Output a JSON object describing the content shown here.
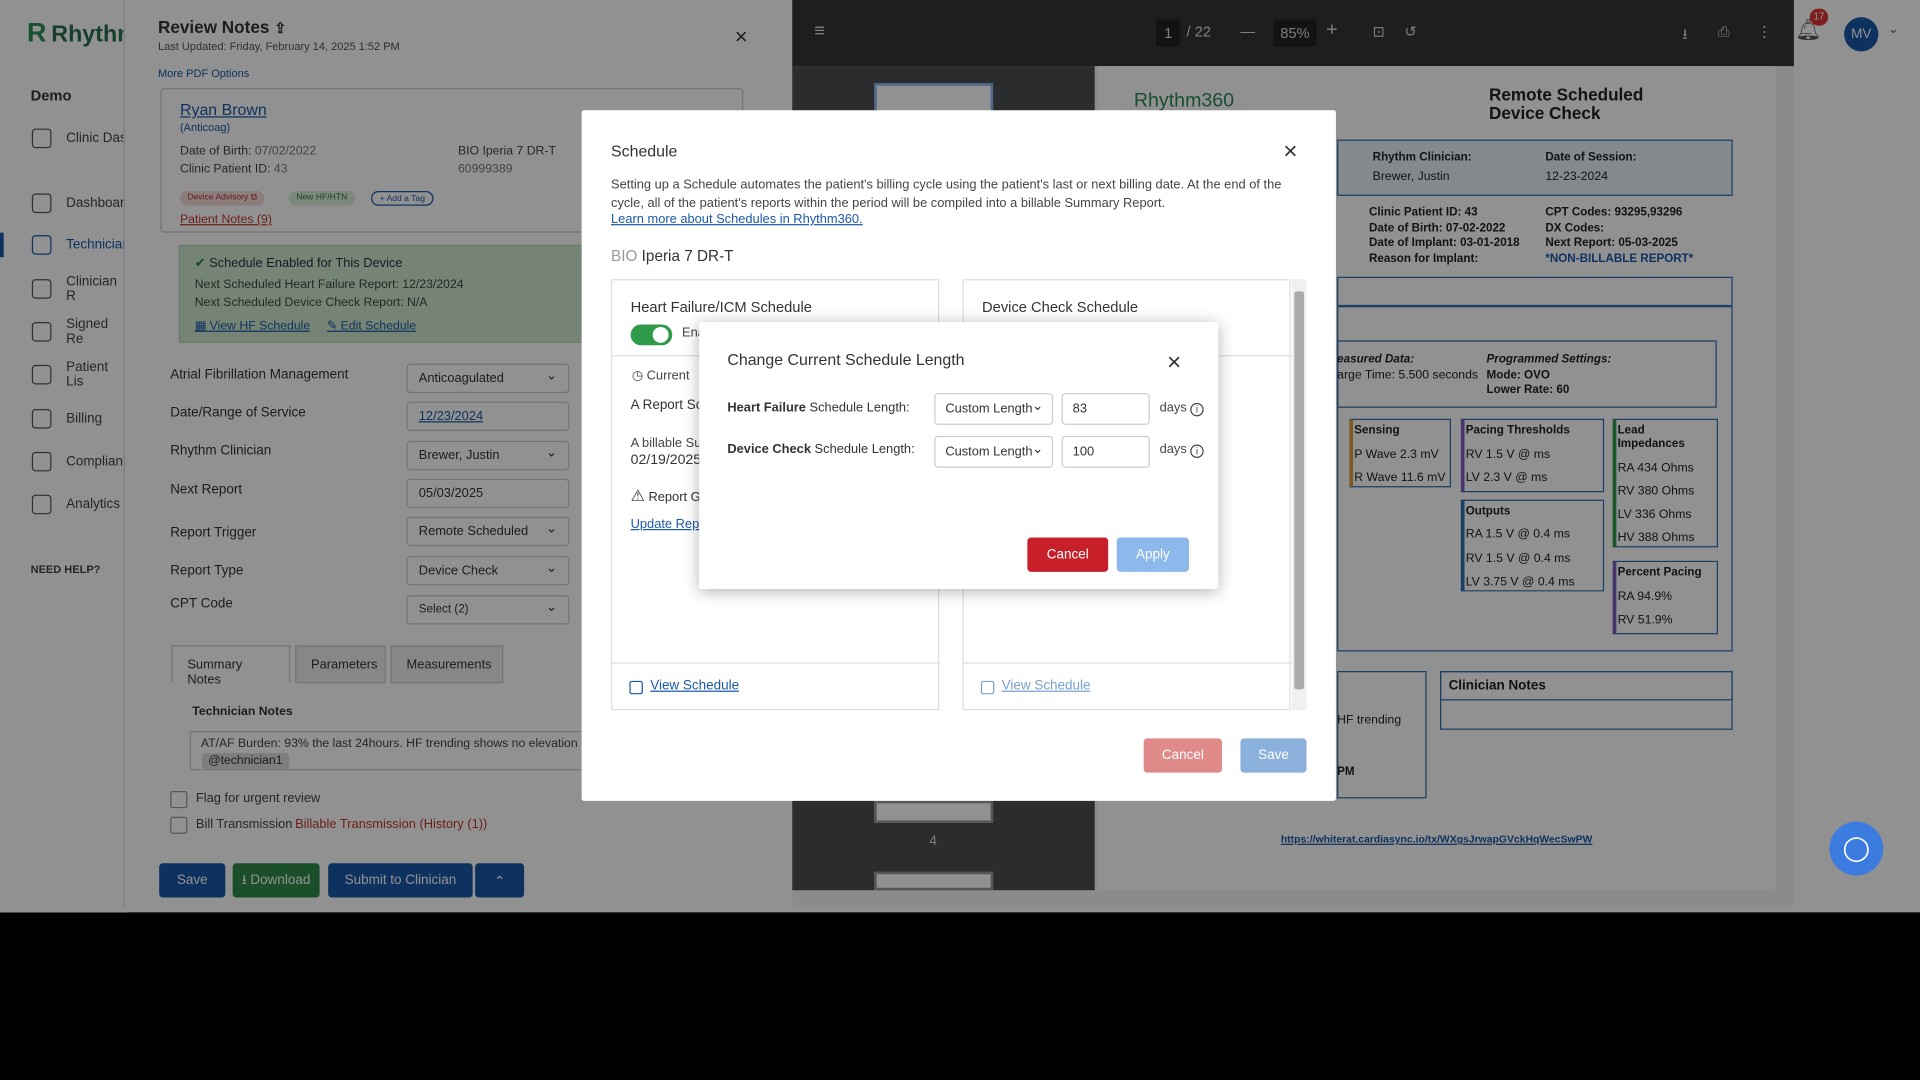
{
  "sidebar": {
    "logo": "Rhythm",
    "section": "Demo",
    "items": [
      {
        "label": "Clinic Das"
      },
      {
        "label": "Dashboar"
      },
      {
        "label": "Technician"
      },
      {
        "label": "Clinician R"
      },
      {
        "label": "Signed Re"
      },
      {
        "label": "Patient Lis"
      },
      {
        "label": "Billing"
      },
      {
        "label": "Complianc"
      },
      {
        "label": "Analytics"
      }
    ],
    "help": "NEED HELP?"
  },
  "review": {
    "title": "Review Notes",
    "updated": "Last Updated: Friday, February 14, 2025 1:52 PM",
    "more_pdf": "More PDF Options",
    "patient": {
      "name": "Ryan Brown",
      "subtitle": "(Anticoag)",
      "dob_label": "Date of Birth:",
      "dob": "07/02/2022",
      "clinic_id_label": "Clinic Patient ID:",
      "clinic_id": "43",
      "device": "BIO Iperia 7 DR-T",
      "serial": "60999389",
      "tags": [
        "Device Advisory",
        "New HF/HTN",
        "+ Add a Tag"
      ],
      "notes_link": "Patient Notes (9)"
    },
    "schedule_box": {
      "title": "Schedule Enabled for This Device",
      "hf_next": "Next Scheduled Heart Failure Report: 12/23/2024",
      "dc_next": "Next Scheduled Device Check Report: N/A",
      "view_hf": "View HF Schedule",
      "edit": "Edit Schedule"
    },
    "fields": [
      {
        "label": "Atrial Fibrillation Management",
        "value": "Anticoagulated"
      },
      {
        "label": "Date/Range of Service",
        "value": "12/23/2024"
      },
      {
        "label": "Rhythm Clinician",
        "value": "Brewer, Justin"
      },
      {
        "label": "Next Report",
        "value": "05/03/2025"
      },
      {
        "label": "Report Trigger",
        "value": "Remote Scheduled"
      },
      {
        "label": "Report Type",
        "value": "Device Check"
      },
      {
        "label": "CPT Code",
        "value": "Select (2)"
      }
    ],
    "tabs": [
      "Summary Notes",
      "Parameters",
      "Measurements"
    ],
    "tech_notes_label": "Technician Notes",
    "tech_notes": "AT/AF Burden: 93% the last 24hours. HF trending shows no elevation",
    "mention": "@technician1",
    "flag_label": "Flag for urgent review",
    "bill_label": "Bill Transmission",
    "bill_link": "Billable Transmission (History (1))",
    "buttons": {
      "save": "Save",
      "download": "Download",
      "submit": "Submit to Clinician"
    }
  },
  "pdf": {
    "page": "1",
    "pages": "/ 22",
    "zoom": "85%",
    "notifications": "17",
    "avatar": "MV",
    "thumb_number": "4",
    "report": {
      "logo": "Rhythm360",
      "title_1": "Remote Scheduled",
      "title_2": "Device Check",
      "clinician_label": "Rhythm Clinician:",
      "clinician": "Brewer, Justin",
      "session_label": "Date of Session:",
      "session": "12-23-2024",
      "clinic_id": "Clinic Patient ID: 43",
      "dob": "Date of Birth: 07-02-2022",
      "implant": "Date of Implant: 03-01-2018",
      "reason": "Reason for Implant:",
      "cpt": "CPT Codes: 93295,93296",
      "dx": "DX Codes:",
      "next": "Next Report: 05-03-2025",
      "nonbill": "*NON-BILLABLE REPORT*",
      "measured": "easured Data:",
      "charge": "arge Time: 5.500 seconds",
      "prog": "Programmed Settings:",
      "mode": "Mode: OVO",
      "lower": "Lower Rate: 60",
      "sensing": "Sensing",
      "pwave": "P Wave   2.3 mV",
      "rwave": "R Wave   11.6 mV",
      "pacing": "Pacing Thresholds",
      "rv_p": "RV     1.5 V @ ms",
      "lv_p": "LV     2.3 V @ ms",
      "leads": "Lead Impedances",
      "ra_i": "RA   434 Ohms",
      "rv_i": "RV   380 Ohms",
      "lv_i": "LV   336 Ohms",
      "hv_i": "HV   388 Ohms",
      "outputs": "Outputs",
      "ra_o": "RA   1.5 V @ 0.4 ms",
      "rv_o": "RV   1.5 V @ 0.4 ms",
      "lv_o": "LV   3.75 V @ 0.4 ms",
      "pct": "Percent Pacing",
      "ra_pct": "RA   94.9%",
      "rv_pct": "RV   51.9%",
      "clin_notes": "Clinician Notes",
      "hf_trend": "HF trending",
      "pm": "PM",
      "url": "https://whiterat.cardiasync.io/tx/WXgsJrwapGVckHqWecSwPW"
    }
  },
  "schedule_modal": {
    "title": "Schedule",
    "desc": "Setting up a Schedule automates the patient's billing cycle using the patient's last or next billing date. At the end of the cycle, all of the patient's reports within the period will be compiled into a billable Summary Report.",
    "learn": "Learn more about Schedules in Rhythm360.",
    "device_brand": "BIO",
    "device_model": "Iperia 7 DR-T",
    "hf_col": {
      "title": "Heart Failure/ICM Schedule",
      "toggle": "Ena",
      "current": "Current",
      "report": "A Report Sc",
      "billable": "A billable Su",
      "date": "02/19/2025",
      "report2": "Report G",
      "update": "Update Repo",
      "view": "View Schedule"
    },
    "dc_col": {
      "title": "Device Check Schedule",
      "view": "View Schedule"
    },
    "cancel": "Cancel",
    "save": "Save"
  },
  "length_dialog": {
    "title": "Change Current Schedule Length",
    "hf_bold": "Heart Failure",
    "dc_bold": "Device Check",
    "suffix": "Schedule Length:",
    "hf_type": "Custom Length",
    "hf_days": "83",
    "dc_type": "Custom Length",
    "dc_days": "100",
    "days": "days",
    "cancel": "Cancel",
    "apply": "Apply"
  }
}
